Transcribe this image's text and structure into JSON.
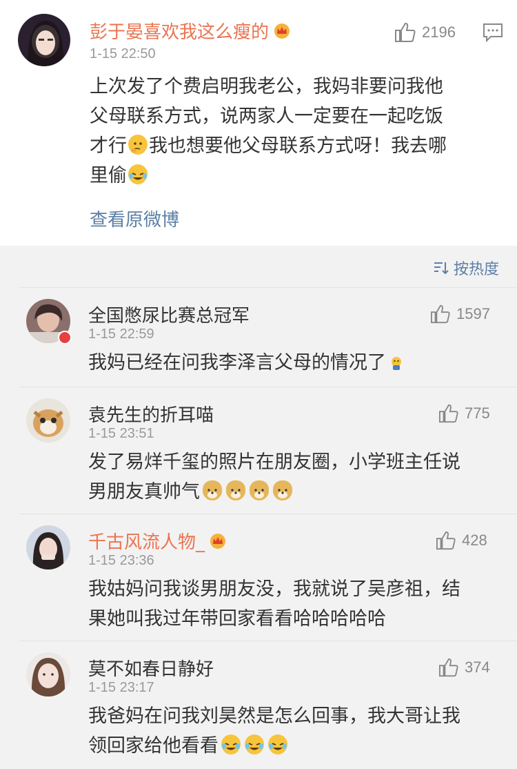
{
  "post": {
    "author": "彭于晏喜欢我这么瘦的",
    "time": "1-15 22:50",
    "likes": "2196",
    "text_lines": [
      "上次发了个费启明我老公，我妈非要问我他",
      "父母联系方式，说两家人一定要在一起吃饭",
      "才行",
      "我也想要他父母联系方式呀！我去哪",
      "里偷"
    ],
    "view_original": "查看原微博"
  },
  "sort": {
    "label": "按热度"
  },
  "comments": [
    {
      "author": "全国憋尿比赛总冠军",
      "time": "1-15 22:59",
      "likes": "1597",
      "lines": [
        "我妈已经在问我李泽言父母的情况了"
      ]
    },
    {
      "author": "袁先生的折耳喵",
      "time": "1-15 23:51",
      "likes": "775",
      "lines": [
        "发了易烊千玺的照片在朋友圈，小学班主任说",
        "男朋友真帅气"
      ]
    },
    {
      "author": "千古风流人物_",
      "time": "1-15 23:36",
      "likes": "428",
      "lines": [
        "我姑妈问我谈男朋友没，我就说了吴彦祖，结",
        "果她叫我过年带回家看看哈哈哈哈哈"
      ]
    },
    {
      "author": "莫不如春日静好",
      "time": "1-15 23:17",
      "likes": "374",
      "lines": [
        "我爸妈在问我刘昊然是怎么回事，我大哥让我",
        "领回家给他看看"
      ]
    }
  ],
  "icons": {
    "like": "thumbs-up-icon",
    "comment": "comment-icon",
    "sort": "sort-icon",
    "crown": "vip-crown-icon"
  },
  "colors": {
    "orange_name": "#eb7350",
    "link": "#5b7fa6",
    "meta": "#999999"
  }
}
